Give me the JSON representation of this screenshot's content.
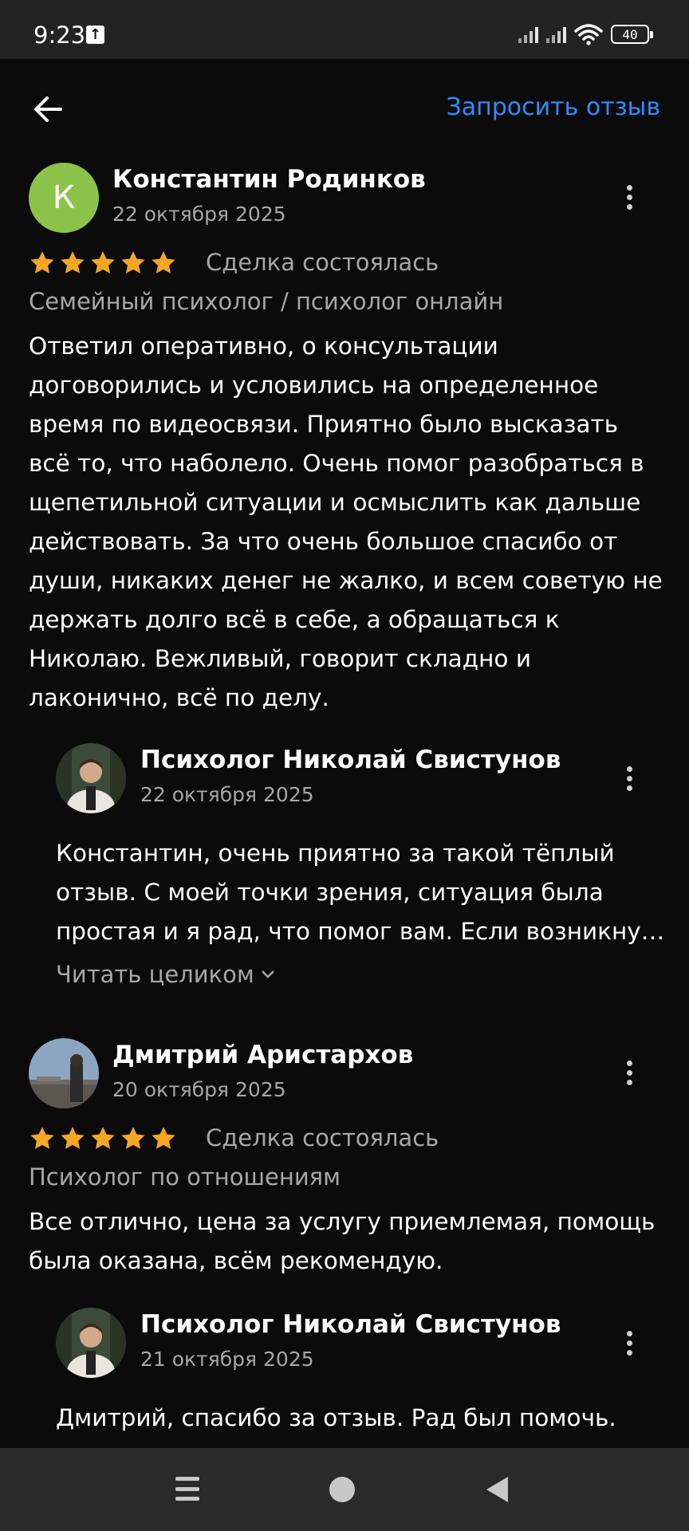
{
  "status_bar": {
    "time": "9:23",
    "battery": "40"
  },
  "header": {
    "request_review": "Запросить отзыв"
  },
  "colors": {
    "accent": "#2f8cff",
    "star": "#f5a623",
    "avatar_letter_bg": "#8bc34a"
  },
  "reviews": [
    {
      "avatar_letter": "К",
      "author": "Константин Родинков",
      "date": "22 октября 2025",
      "rating": 5,
      "status": "Сделка состоялась",
      "category": "Семейный психолог / психолог онлайн",
      "text": "Ответил оперативно, о консультации договорились и условились на определенное время по видеосвязи. Приятно было высказать всё то, что наболело. Очень помог разобраться в щепетильной ситуации и осмыслить как дальше действовать. За что очень большое спасибо от души, никаких денег не жалко, и всем советую не держать долго всё в себе, а обращаться к Николаю. Вежливый, говорит складно и лаконично, всё по делу.",
      "reply": {
        "author": "Психолог Николай Свистунов",
        "date": "22 октября 2025",
        "text": "Константин, очень приятно за такой тёплый отзыв. С моей точки зрения, ситуация была простая и я рад, что  помог вам. Если возникну…",
        "read_more": "Читать целиком"
      }
    },
    {
      "author": "Дмитрий Аристархов",
      "date": "20 октября 2025",
      "rating": 5,
      "status": "Сделка состоялась",
      "category": "Психолог по отношениям",
      "text": "Все отлично, цена за услугу приемлемая, помощь была оказана, всём рекомендую.",
      "reply": {
        "author": "Психолог Николай Свистунов",
        "date": "21 октября 2025",
        "text": "Дмитрий, спасибо за отзыв. Рад был помочь."
      }
    }
  ]
}
